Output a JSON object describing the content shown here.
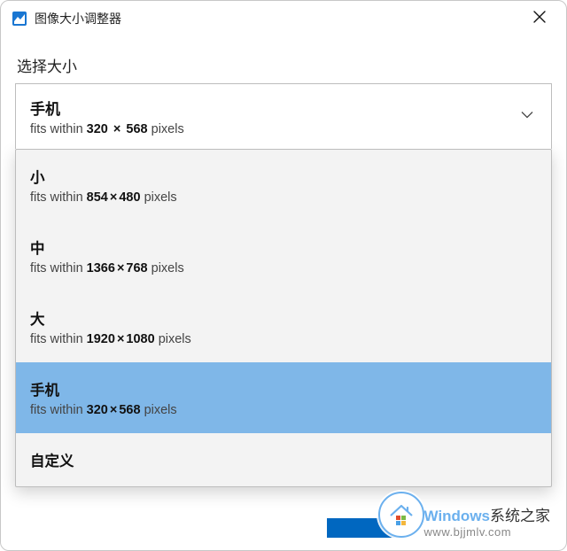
{
  "window": {
    "title": "图像大小调整器"
  },
  "section": {
    "label": "选择大小"
  },
  "selected": {
    "title": "手机",
    "prefix": "fits within",
    "width": "320",
    "height": "568",
    "suffix": "pixels"
  },
  "options": [
    {
      "title": "小",
      "prefix": "fits within",
      "width": "854",
      "height": "480",
      "suffix": "pixels",
      "selected": false
    },
    {
      "title": "中",
      "prefix": "fits within",
      "width": "1366",
      "height": "768",
      "suffix": "pixels",
      "selected": false
    },
    {
      "title": "大",
      "prefix": "fits within",
      "width": "1920",
      "height": "1080",
      "suffix": "pixels",
      "selected": false
    },
    {
      "title": "手机",
      "prefix": "fits within",
      "width": "320",
      "height": "568",
      "suffix": "pixels",
      "selected": true
    },
    {
      "title": "自定义",
      "custom": true,
      "selected": false
    }
  ],
  "watermark": {
    "brand_colored": "Windows",
    "brand_rest": "系统之家",
    "url": "www.bjjmlv.com"
  },
  "glyphs": {
    "times": "×"
  }
}
